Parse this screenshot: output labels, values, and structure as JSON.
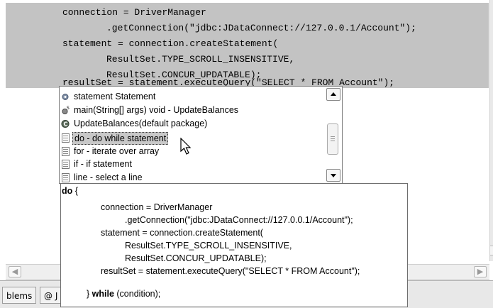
{
  "editor": {
    "code_lines": [
      "connection = DriverManager",
      ".getConnection(\"jdbc:JDataConnect://127.0.0.1/Account\");",
      "statement = connection.createStatement(",
      "ResultSet.TYPE_SCROLL_INSENSITIVE,",
      "ResultSet.CONCUR_UPDATABLE);",
      "resultSet = statement.executeQuery(\"SELECT * FROM Account\");"
    ]
  },
  "popup": {
    "items": [
      {
        "icon": "field-icon",
        "label": "statement    Statement",
        "selected": false
      },
      {
        "icon": "static-method-icon",
        "label": "main(String[] args)  void - UpdateBalances",
        "selected": false
      },
      {
        "icon": "class-icon",
        "label": "UpdateBalances(default package)",
        "selected": false
      },
      {
        "icon": "template-icon",
        "label": "do - do while statement",
        "selected": true
      },
      {
        "icon": "template-icon",
        "label": "for - iterate over array",
        "selected": false
      },
      {
        "icon": "template-icon",
        "label": "if - if statement",
        "selected": false
      },
      {
        "icon": "template-icon",
        "label": "line - select a line",
        "selected": false
      }
    ]
  },
  "preview": {
    "lines": {
      "do_kw": "do",
      "open_brace": " {",
      "l1": "connection = DriverManager",
      "l2": ".getConnection(\"jdbc:JDataConnect://127.0.0.1/Account\");",
      "l3": "statement = connection.createStatement(",
      "l4": "ResultSet.TYPE_SCROLL_INSENSITIVE,",
      "l5": "ResultSet.CONCUR_UPDATABLE);",
      "l6": "resultSet = statement.executeQuery(\"SELECT * FROM Account\");",
      "close_brace": "} ",
      "while_kw": "while",
      "condition": " (condition);"
    }
  },
  "bottom_tabs": {
    "problems": "blems",
    "javadoc": "@ J"
  },
  "colors": {
    "selection": "#c3c3c3",
    "popup_selection": "#c8c8c8"
  }
}
